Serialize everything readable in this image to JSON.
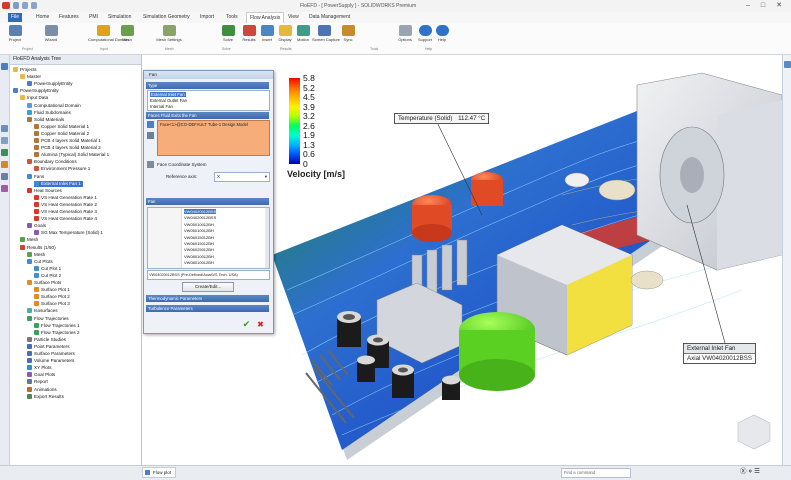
{
  "window": {
    "title": "FloEFD - [ PowerSupply ] - SOLIDWORKS Premium",
    "min_label": "–",
    "max_label": "□",
    "close_label": "✕"
  },
  "menu": {
    "tabs": [
      "File",
      "Home",
      "Features",
      "PMI",
      "Simulation",
      "Simulation Geometry",
      "Import",
      "Tools",
      "Flow Analysis",
      "View",
      "Data Management"
    ],
    "active": "Flow Analysis"
  },
  "ribbon": {
    "buttons": [
      "Project",
      "Wizard",
      "Computational Domain",
      "Mesh",
      "Mesh Settings",
      "Solve",
      "Results",
      "Insert",
      "Display",
      "Motion",
      "Screen Capture",
      "Sync",
      "Options",
      "Support",
      "Help"
    ],
    "groups": [
      "Project",
      "Input",
      "Mesh",
      "Solve",
      "Results",
      "Tools",
      "Help"
    ]
  },
  "tree": {
    "panel_title": "FloEFD Analysis Tree",
    "items": [
      {
        "label": "Projects",
        "level": 0,
        "icon": "folder-icon"
      },
      {
        "label": "Master",
        "level": 1,
        "icon": "folder-icon"
      },
      {
        "label": "PowerSupplyEntity",
        "level": 2,
        "icon": "project-icon"
      },
      {
        "label": "PowerSupplyEntity",
        "level": 0,
        "icon": "project-icon"
      },
      {
        "label": "Input Data",
        "level": 1,
        "icon": "folder-icon"
      },
      {
        "label": "Computational Domain",
        "level": 2,
        "icon": "domain-icon"
      },
      {
        "label": "Fluid Subdomains",
        "level": 2,
        "icon": "fluid-icon"
      },
      {
        "label": "Solid Materials",
        "level": 2,
        "icon": "material-icon"
      },
      {
        "label": "Copper Solid Material 1",
        "level": 3,
        "icon": "material-icon"
      },
      {
        "label": "Copper Solid Material 2",
        "level": 3,
        "icon": "material-icon"
      },
      {
        "label": "PCB 4 layers Solid Material 1",
        "level": 3,
        "icon": "material-icon"
      },
      {
        "label": "PCB 4 layers Solid Material 2",
        "level": 3,
        "icon": "material-icon"
      },
      {
        "label": "Alumina (Typical) Solid Material 1",
        "level": 3,
        "icon": "material-icon"
      },
      {
        "label": "Boundary Conditions",
        "level": 2,
        "icon": "boundary-icon"
      },
      {
        "label": "Environment Pressure 1",
        "level": 3,
        "icon": "pressure-icon"
      },
      {
        "label": "Fans",
        "level": 2,
        "icon": "fan-icon"
      },
      {
        "label": "External Inlet Fan 1",
        "level": 3,
        "icon": "fan-icon",
        "selected": true
      },
      {
        "label": "Heat Sources",
        "level": 2,
        "icon": "heat-icon"
      },
      {
        "label": "VS Heat Generation Rate 1",
        "level": 3,
        "icon": "heat-icon"
      },
      {
        "label": "VS Heat Generation Rate 2",
        "level": 3,
        "icon": "heat-icon"
      },
      {
        "label": "VS Heat Generation Rate 3",
        "level": 3,
        "icon": "heat-icon"
      },
      {
        "label": "VS Heat Generation Rate 4",
        "level": 3,
        "icon": "heat-icon"
      },
      {
        "label": "Goals",
        "level": 2,
        "icon": "goal-icon"
      },
      {
        "label": "SG Max Temperature (Solid) 1",
        "level": 3,
        "icon": "goal-icon"
      },
      {
        "label": "Mesh",
        "level": 1,
        "icon": "mesh-icon"
      },
      {
        "label": "Results (1/50)",
        "level": 1,
        "icon": "results-icon"
      },
      {
        "label": "Mesh",
        "level": 2,
        "icon": "mesh-icon"
      },
      {
        "label": "Cut Plots",
        "level": 2,
        "icon": "cutplot-icon"
      },
      {
        "label": "Cut Plot 1",
        "level": 3,
        "icon": "cutplot-icon"
      },
      {
        "label": "Cut Plot 2",
        "level": 3,
        "icon": "cutplot-icon"
      },
      {
        "label": "Surface Plots",
        "level": 2,
        "icon": "surfaceplot-icon"
      },
      {
        "label": "Surface Plot 1",
        "level": 3,
        "icon": "surfaceplot-icon"
      },
      {
        "label": "Surface Plot 2",
        "level": 3,
        "icon": "surfaceplot-icon"
      },
      {
        "label": "Surface Plot 3",
        "level": 3,
        "icon": "surfaceplot-icon"
      },
      {
        "label": "Isosurfaces",
        "level": 2,
        "icon": "isosurface-icon"
      },
      {
        "label": "Flow Trajectories",
        "level": 2,
        "icon": "trajectory-icon"
      },
      {
        "label": "Flow Trajectories 1",
        "level": 3,
        "icon": "trajectory-icon"
      },
      {
        "label": "Flow Trajectories 2",
        "level": 3,
        "icon": "trajectory-icon"
      },
      {
        "label": "Particle Studies",
        "level": 2,
        "icon": "particle-icon"
      },
      {
        "label": "Point Parameters",
        "level": 2,
        "icon": "point-icon"
      },
      {
        "label": "Surface Parameters",
        "level": 2,
        "icon": "surface-param-icon"
      },
      {
        "label": "Volume Parameters",
        "level": 2,
        "icon": "volume-param-icon"
      },
      {
        "label": "XY Plots",
        "level": 2,
        "icon": "xyplot-icon"
      },
      {
        "label": "Goal Plots",
        "level": 2,
        "icon": "goalplot-icon"
      },
      {
        "label": "Report",
        "level": 2,
        "icon": "report-icon"
      },
      {
        "label": "Animations",
        "level": 2,
        "icon": "animation-icon"
      },
      {
        "label": "Export Results",
        "level": 2,
        "icon": "export-icon"
      }
    ]
  },
  "dialog": {
    "title": "Fan",
    "type_section": "Type",
    "type_options": [
      "External Inlet Fan",
      "External Outlet Fan",
      "Internal Fan"
    ],
    "faces_section": "Faces Fluid Exits the Fan",
    "faces_value": "Face<1>@CO-DEFAULT Tube-1 Design Model",
    "coord_label": "Face Coordinate System",
    "ref_axis_label": "Reference axis:",
    "ref_axis_value": "X",
    "fan_section": "Fan",
    "fan_list": [
      "VW04020012BSS",
      "VW04020012BSS",
      "VW05010012BH",
      "VW05010012BH",
      "VW06015012BH",
      "VW06015012BH",
      "VW06025012BH",
      "VW08010012BH",
      "VW08010012BH"
    ],
    "fan_selected": "VW04020012BSS (Pre-Defined\\Axial\\VS Tech. USA)",
    "create_edit_label": "Create/Edit...",
    "thermo_section": "Thermodynamic Parameters",
    "turb_section": "Turbulence Parameters",
    "ok_label": "✔",
    "cancel_label": "✖"
  },
  "legend": {
    "values": [
      "5.8",
      "5.2",
      "4.5",
      "3.9",
      "3.2",
      "2.6",
      "1.9",
      "1.3",
      "0.6",
      "0"
    ],
    "title": "Velocity [m/s]",
    "colors": [
      "#ff0000",
      "#ff6a00",
      "#ffb400",
      "#fff000",
      "#b4ff00",
      "#00ff5a",
      "#00ffd2",
      "#00b4ff",
      "#0050ff",
      "#0000aa"
    ]
  },
  "callouts": {
    "temperature": {
      "label": "Temperature (Solid)",
      "value": "112.47 °C"
    },
    "fan": {
      "line1": "External Inlet Fan",
      "line2": "Axial VW04020012BSS"
    }
  },
  "status": {
    "tab_label": "Flow plot",
    "search_placeholder": "Find a command",
    "zoom_text": "Ⓧ ⋄ ☰"
  }
}
